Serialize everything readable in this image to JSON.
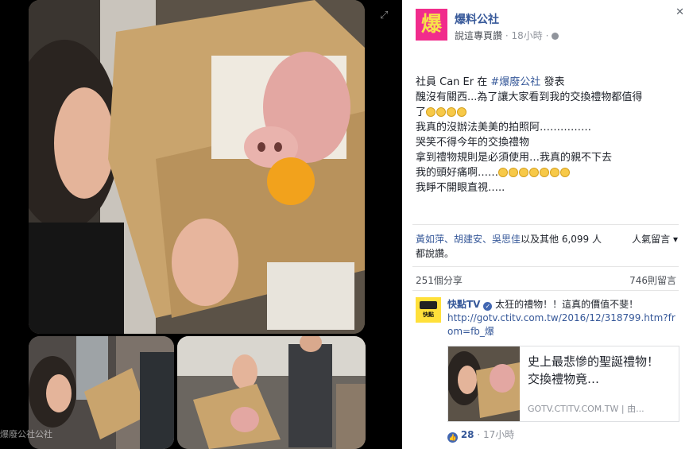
{
  "post": {
    "page_name": "爆料公社",
    "avatar_char": "爆",
    "shared_by": "說這專頁讚",
    "time": "18小時",
    "header_line_user": "社員 Can Er 在",
    "header_line_group": "#爆廢公社",
    "header_line_end": "發表",
    "lines": [
      "醜沒有關西...為了讓大家看到我的交換禮物都值得",
      "了",
      "我真的沒辦法美美的拍照阿……………",
      "哭笑不得今年的交換禮物",
      "拿到禮物規則是必須使用…我真的親不下去",
      "我的頭好痛啊……",
      "我睜不開眼直視….."
    ]
  },
  "likes": {
    "names": "黃如萍、胡建安、吳思佳",
    "and_others": "以及其他 6,099 人",
    "suffix": "都說讚。",
    "sort_label": "人氣留言 ▾"
  },
  "stats": {
    "shares": "251個分享",
    "comments": "746則留言"
  },
  "comment": {
    "author": "快點TV",
    "text": "太狂的禮物！！這真的價值不斐！",
    "url": "http://gotv.ctitv.com.tw/2016/12/318799.htm?from=fb_爆",
    "preview_title": "史上最悲慘的聖誕禮物！　交換禮物竟…",
    "preview_domain": "GOTV.CTITV.COM.TW | 由...",
    "like_count": "28",
    "time": "17小時"
  },
  "viewer": {
    "watermark": "爆廢公社公社"
  },
  "colors": {
    "link": "#365899",
    "avatar_bg": "#f12c8c",
    "like_blue": "#4267b2"
  },
  "icons": [
    "expand-icon",
    "close-icon",
    "globe-icon",
    "verified-icon",
    "like-icon",
    "emoji-icon"
  ]
}
